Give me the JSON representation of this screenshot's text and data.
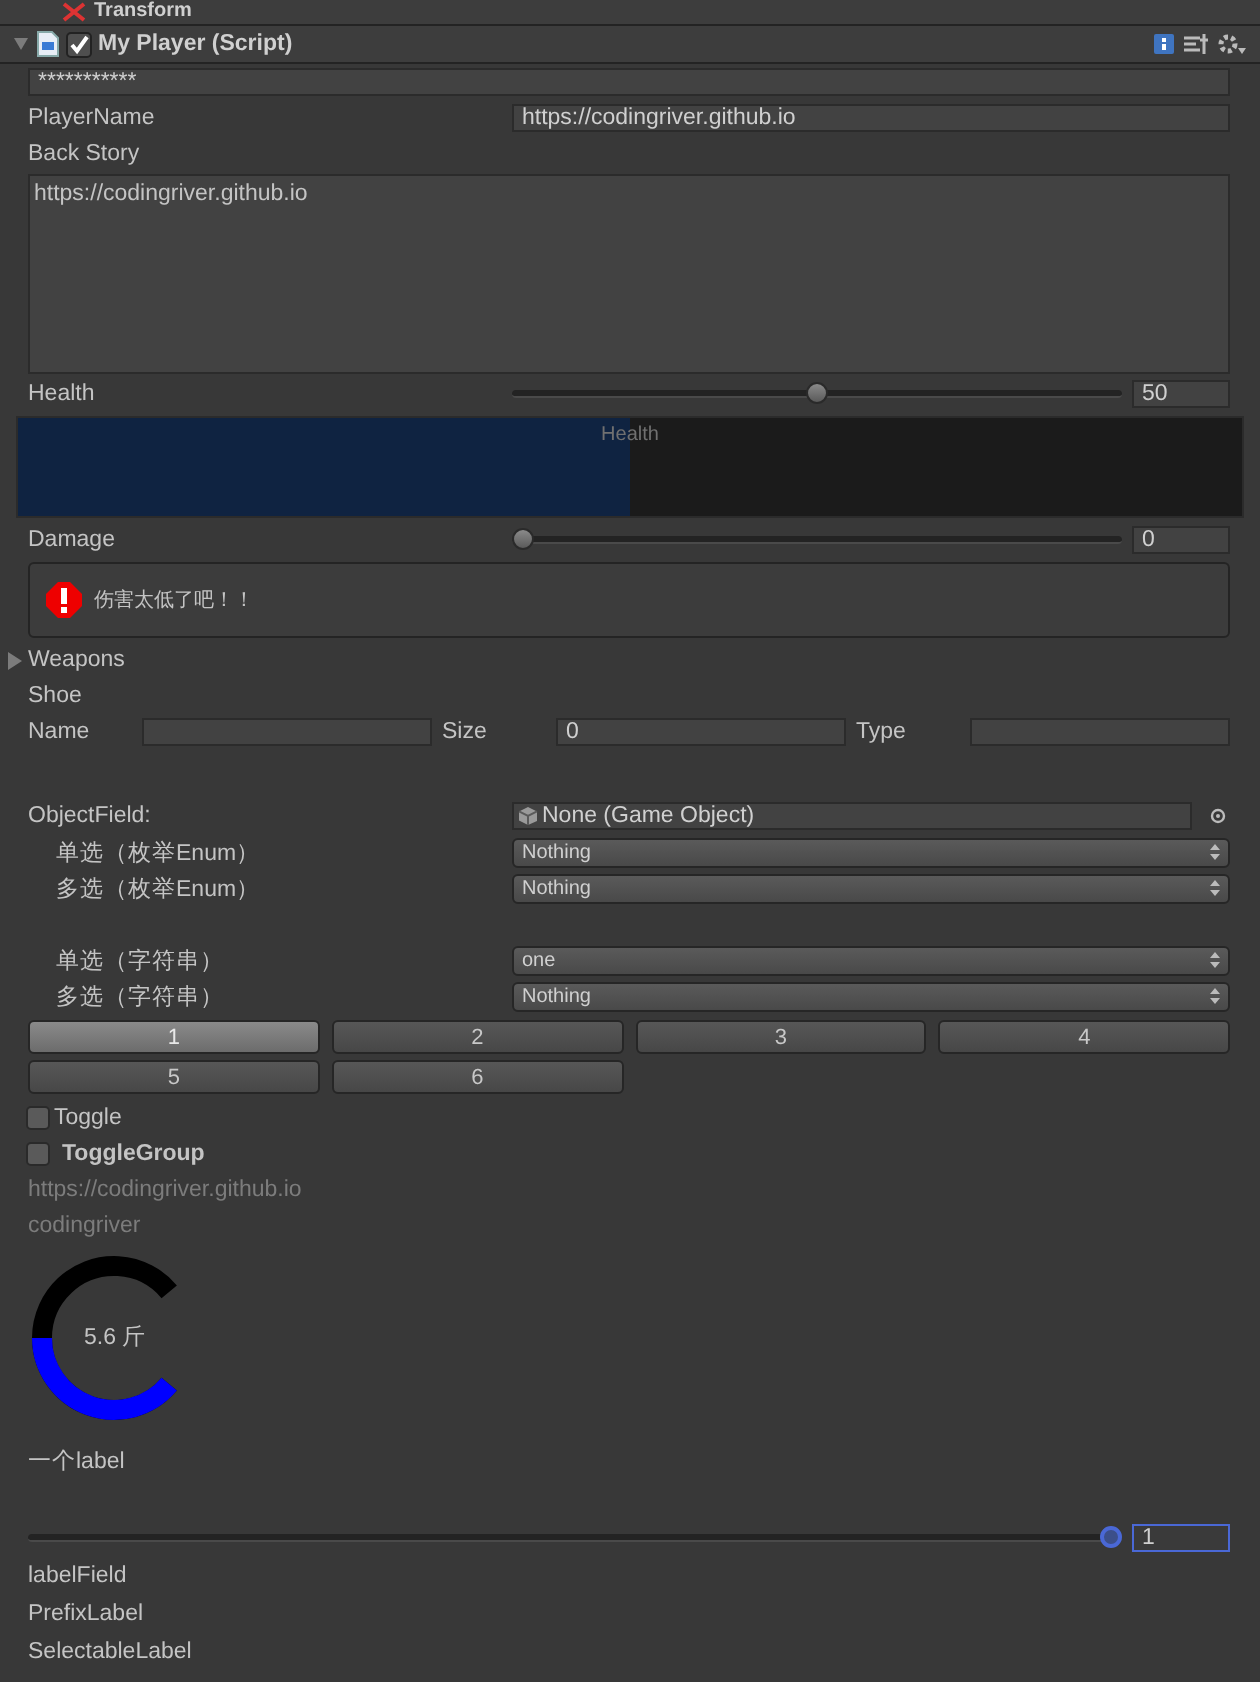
{
  "transform_header": {
    "title": "Transform"
  },
  "component": {
    "title": "My Player (Script)",
    "enabled": true
  },
  "password": {
    "value": "***********"
  },
  "player_name": {
    "label": "PlayerName",
    "value": "https://codingriver.github.io"
  },
  "back_story": {
    "label": "Back Story",
    "value": "https://codingriver.github.io"
  },
  "health": {
    "label": "Health",
    "level": 0.5,
    "reading": "50"
  },
  "health_bar": {
    "label": "Health",
    "level": 0.5
  },
  "damage": {
    "label": "Damage",
    "level": 0,
    "reading": "0"
  },
  "help_box": {
    "kind": "error",
    "message": "伤害太低了吧！！"
  },
  "weapons": {
    "label": "Weapons",
    "expanded": false
  },
  "shoe": {
    "label": "Shoe",
    "fields": [
      {
        "label": "Name"
      },
      {
        "label": "Size",
        "value": "0"
      },
      {
        "label": "Type"
      }
    ]
  },
  "object_field": {
    "label": "ObjectField:",
    "value": "None (Game Object)"
  },
  "enum_popups": [
    {
      "label": "单选（枚举Enum）",
      "value": "Nothing"
    },
    {
      "label": "多选（枚举Enum）",
      "value": "Nothing"
    }
  ],
  "string_popups": [
    {
      "label": "单选（字符串）",
      "value": "one"
    },
    {
      "label": "多选（字符串）",
      "value": "Nothing"
    }
  ],
  "buttons": [
    {
      "label": "1",
      "selected": true
    },
    {
      "label": "2",
      "selected": false
    },
    {
      "label": "3",
      "selected": false
    },
    {
      "label": "4",
      "selected": false
    },
    {
      "label": "5",
      "selected": false
    },
    {
      "label": "6",
      "selected": false
    }
  ],
  "toggle": {
    "label": "Toggle",
    "checked": false
  },
  "toggle_group": {
    "label": "ToggleGroup",
    "checked": false
  },
  "disabled_texts": [
    "https://codingriver.github.io",
    "codingriver"
  ],
  "ring": {
    "reading": "5.6 斤",
    "level": 0.5
  },
  "label_text": "一个label",
  "slider": {
    "level": 1,
    "reading": "1"
  },
  "labels": [
    "labelField",
    "PrefixLabel",
    "SelectableLabel"
  ]
}
